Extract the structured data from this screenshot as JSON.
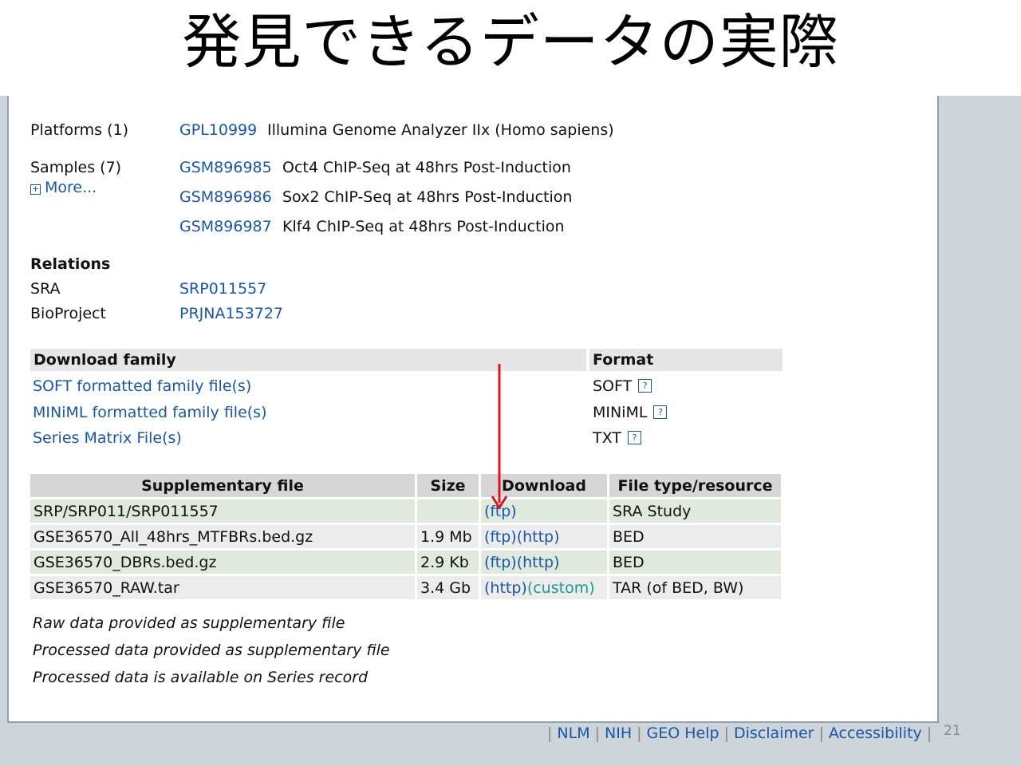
{
  "slide": {
    "title": "発見できるデータの実際",
    "page_number": "21"
  },
  "platforms": {
    "label": "Platforms (1)",
    "items": [
      {
        "id": "GPL10999",
        "desc": "Illumina Genome Analyzer IIx (Homo sapiens)"
      }
    ]
  },
  "samples": {
    "label": "Samples (7)",
    "more": "More...",
    "items": [
      {
        "id": "GSM896985",
        "desc": "Oct4 ChIP-Seq at 48hrs Post-Induction"
      },
      {
        "id": "GSM896986",
        "desc": "Sox2 ChIP-Seq at 48hrs Post-Induction"
      },
      {
        "id": "GSM896987",
        "desc": "Klf4 ChIP-Seq at 48hrs Post-Induction"
      }
    ]
  },
  "relations": {
    "heading": "Relations",
    "items": [
      {
        "label": "SRA",
        "id": "SRP011557"
      },
      {
        "label": "BioProject",
        "id": "PRJNA153727"
      }
    ]
  },
  "download_family": {
    "header": "Download family",
    "format_header": "Format",
    "rows": [
      {
        "link": "SOFT formatted family file(s)",
        "format": "SOFT",
        "help": "?"
      },
      {
        "link": "MINiML formatted family file(s)",
        "format": "MINiML",
        "help": "?"
      },
      {
        "link": "Series Matrix File(s)",
        "format": "TXT",
        "help": "?"
      }
    ]
  },
  "supplementary": {
    "headers": [
      "Supplementary file",
      "Size",
      "Download",
      "File type/resource"
    ],
    "rows": [
      {
        "file": "SRP/SRP011/SRP011557",
        "size": "",
        "links": [
          "(ftp)"
        ],
        "type": "SRA Study"
      },
      {
        "file": "GSE36570_All_48hrs_MTFBRs.bed.gz",
        "size": "1.9 Mb",
        "links": [
          "(ftp)",
          "(http)"
        ],
        "type": "BED"
      },
      {
        "file": "GSE36570_DBRs.bed.gz",
        "size": "2.9 Kb",
        "links": [
          "(ftp)",
          "(http)"
        ],
        "type": "BED"
      },
      {
        "file": "GSE36570_RAW.tar",
        "size": "3.4 Gb",
        "links": [
          "(http)",
          "(custom)"
        ],
        "type": "TAR (of BED, BW)"
      }
    ],
    "notes": [
      "Raw data provided as supplementary file",
      "Processed data provided as supplementary file",
      "Processed data is available on Series record"
    ]
  },
  "footer": {
    "links": [
      "NLM",
      "NIH",
      "GEO Help",
      "Disclaimer",
      "Accessibility"
    ],
    "separator": "|"
  },
  "colors": {
    "link": "#1a56a8",
    "arrow": "#e0141e",
    "row_green": "#dfe9dc",
    "row_grey": "#ececec",
    "header_grey": "#d6d6d6"
  }
}
